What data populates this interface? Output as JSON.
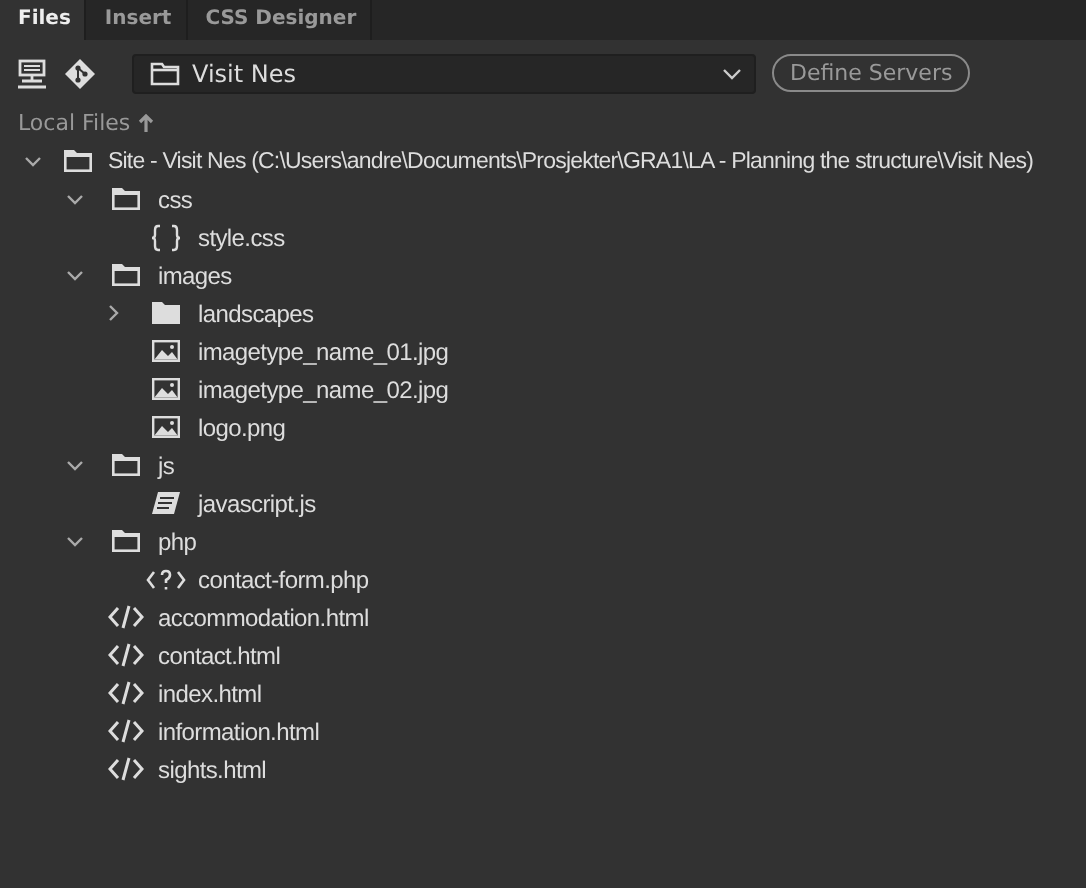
{
  "tabs": [
    {
      "label": "Files",
      "selected": true
    },
    {
      "label": "Insert",
      "selected": false
    },
    {
      "label": "CSS Designer",
      "selected": false
    }
  ],
  "site_select": {
    "value": "Visit Nes"
  },
  "define_servers_button": "Define Servers",
  "view_label": "Local Files",
  "tree": [
    {
      "kind": "folder",
      "label": "Site - Visit Nes (C:\\Users\\andre\\Documents\\Prosjekter\\GRA1\\LA - Planning the structure\\Visit Nes)",
      "expanded": true,
      "children": [
        {
          "kind": "folder",
          "label": "css",
          "expanded": true,
          "children": [
            {
              "kind": "css",
              "label": "style.css"
            }
          ]
        },
        {
          "kind": "folder",
          "label": "images",
          "expanded": true,
          "children": [
            {
              "kind": "folder",
              "label": "landscapes",
              "expanded": false
            },
            {
              "kind": "image",
              "label": "imagetype_name_01.jpg"
            },
            {
              "kind": "image",
              "label": "imagetype_name_02.jpg"
            },
            {
              "kind": "image",
              "label": "logo.png"
            }
          ]
        },
        {
          "kind": "folder",
          "label": "js",
          "expanded": true,
          "children": [
            {
              "kind": "js",
              "label": "javascript.js"
            }
          ]
        },
        {
          "kind": "folder",
          "label": "php",
          "expanded": true,
          "children": [
            {
              "kind": "php",
              "label": "contact-form.php"
            }
          ]
        },
        {
          "kind": "html",
          "label": "accommodation.html"
        },
        {
          "kind": "html",
          "label": "contact.html"
        },
        {
          "kind": "html",
          "label": "index.html"
        },
        {
          "kind": "html",
          "label": "information.html"
        },
        {
          "kind": "html",
          "label": "sights.html"
        }
      ]
    }
  ]
}
